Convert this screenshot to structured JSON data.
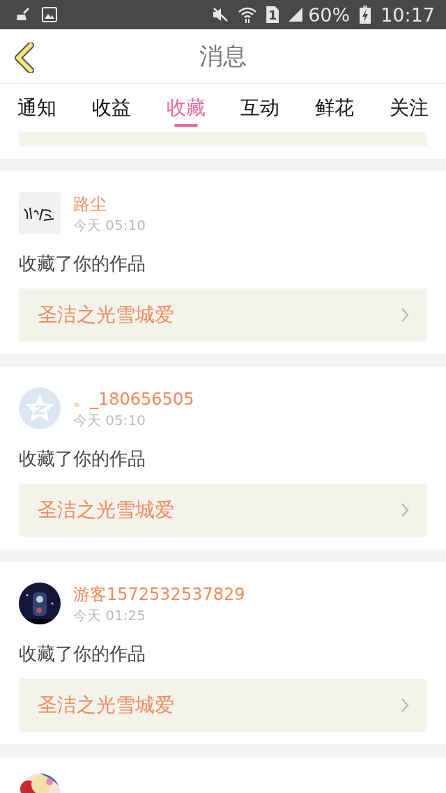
{
  "status_bar": {
    "sim_label": "1",
    "battery": "60%",
    "time": "10:17"
  },
  "header": {
    "title": "消息"
  },
  "tabs": [
    {
      "label": "通知",
      "selected": false
    },
    {
      "label": "收益",
      "selected": false
    },
    {
      "label": "收藏",
      "selected": true
    },
    {
      "label": "互动",
      "selected": false
    },
    {
      "label": "鲜花",
      "selected": false
    },
    {
      "label": "关注",
      "selected": false
    }
  ],
  "items": [
    {
      "kind": "stub"
    },
    {
      "kind": "message",
      "name": "路尘",
      "time": "今天 05:10",
      "action": "收藏了你的作品",
      "work": "圣洁之光雪城爱"
    },
    {
      "kind": "message",
      "avatar": {
        "kind": "default"
      },
      "name": "。_180656505",
      "time": "今天 05:10",
      "action": "收藏了你的作品",
      "work": "圣洁之光雪城爱"
    },
    {
      "kind": "message",
      "name": "游客1572532537829",
      "time": "今天 01:25",
      "action": "收藏了你的作品",
      "work": "圣洁之光雪城爱"
    },
    {
      "kind": "tail"
    }
  ]
}
